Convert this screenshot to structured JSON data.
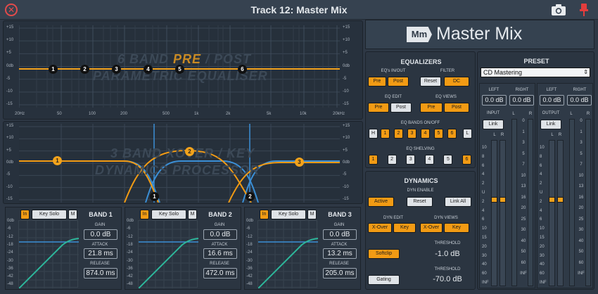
{
  "window": {
    "title": "Track 12: Master Mix"
  },
  "logo": {
    "badge": "Mm",
    "name": "Master Mix"
  },
  "eq_graph": {
    "db_labels": [
      "+15",
      "+10",
      "+5",
      "0db",
      "-5",
      "-10",
      "-15"
    ],
    "freq_labels": [
      "20Hz",
      "50",
      "100",
      "200",
      "500",
      "1k",
      "2k",
      "5k",
      "10k",
      "20kHz"
    ],
    "watermark_line1_a": "6 BAND ",
    "watermark_line1_b": "PRE",
    "watermark_line1_c": " / POST",
    "watermark_line2": "PARAMETRIC EQUALISER",
    "bands": [
      "1",
      "2",
      "3",
      "4",
      "5",
      "6"
    ]
  },
  "xover_graph": {
    "db_labels": [
      "+15",
      "+10",
      "+5",
      "0db",
      "-5",
      "-10",
      "-15"
    ],
    "watermark_line1": "3 BAND XOVER / KEY",
    "watermark_line2": "DYNAMICS PROCESSOR",
    "orange_bands": [
      "1",
      "2",
      "3"
    ],
    "crossover_points": [
      "1",
      "2"
    ]
  },
  "dyn_bands": [
    {
      "title": "BAND 1",
      "in": "In",
      "key_solo": "Key Solo",
      "m": "M",
      "gain_label": "GAIN",
      "gain": "0.0 dB",
      "attack_label": "ATTACK",
      "attack": "21.8 ms",
      "release_label": "RELEASE",
      "release": "874.0 ms",
      "scale": [
        "0db",
        "-6",
        "-12",
        "-18",
        "-24",
        "-30",
        "-36",
        "-42",
        "-48"
      ]
    },
    {
      "title": "BAND 2",
      "in": "In",
      "key_solo": "Key Solo",
      "m": "M",
      "gain_label": "GAIN",
      "gain": "0.0 dB",
      "attack_label": "ATTACK",
      "attack": "16.6 ms",
      "release_label": "RELEASE",
      "release": "472.0 ms",
      "scale": [
        "0db",
        "-6",
        "-12",
        "-18",
        "-24",
        "-30",
        "-36",
        "-42",
        "-48"
      ]
    },
    {
      "title": "BAND 3",
      "in": "In",
      "key_solo": "Key Solo",
      "m": "M",
      "gain_label": "GAIN",
      "gain": "0.0 dB",
      "attack_label": "ATTACK",
      "attack": "13.2 ms",
      "release_label": "RELEASE",
      "release": "205.0 ms",
      "scale": [
        "0db",
        "-6",
        "-12",
        "-18",
        "-24",
        "-30",
        "-36",
        "-42",
        "-48"
      ]
    }
  ],
  "equalizers": {
    "title": "EQUALIZERS",
    "eqs_inout_label": "EQ's IN/OUT",
    "filter_label": "FILTER",
    "pre": "Pre",
    "post": "Post",
    "reset": "Reset",
    "dc": "DC",
    "eq_edit_label": "EQ EDIT",
    "eq_views_label": "EQ VIEWS",
    "bands_label": "EQ BANDS ON/OFF",
    "h": "H",
    "l": "L",
    "band_buttons": [
      "1",
      "2",
      "3",
      "4",
      "5",
      "6"
    ],
    "shelving_label": "EQ SHELVING",
    "shelving_buttons": [
      "1",
      "2",
      "3",
      "4",
      "5",
      "6"
    ]
  },
  "dynamics": {
    "title": "DYNAMICS",
    "enable_label": "DYN ENABLE",
    "active": "Active",
    "reset": "Reset",
    "link_all": "Link All",
    "edit_label": "DYN EDIT",
    "views_label": "DYN VIEWS",
    "xover": "X-Over",
    "key": "Key",
    "softclip": "Softclip",
    "gating": "Gating",
    "threshold_label": "THRESHOLD",
    "softclip_threshold": "-1.0 dB",
    "gating_threshold": "-70.0 dB"
  },
  "preset": {
    "title": "PRESET",
    "selected": "CD Mastering",
    "input": {
      "label": "INPUT",
      "left": "LEFT",
      "right": "RIGHT",
      "left_val": "0.0 dB",
      "right_val": "0.0 dB",
      "link": "Link",
      "l": "L",
      "r": "R",
      "level_left": 0.6,
      "level_right": 0.6
    },
    "output": {
      "label": "OUTPUT",
      "left": "LEFT",
      "right": "RIGHT",
      "left_val": "0.0 dB",
      "right_val": "0.0 dB",
      "link": "Link",
      "l": "L",
      "r": "R",
      "level_left": 0.6,
      "level_right": 0.6
    },
    "fader_scale": [
      "10",
      "8",
      "6",
      "4",
      "2",
      "U",
      "2",
      "4",
      "6",
      "10",
      "15",
      "20",
      "30",
      "40",
      "60",
      "INF"
    ],
    "meter_scale": [
      "0",
      "1",
      "3",
      "5",
      "7",
      "10",
      "13",
      "16",
      "20",
      "25",
      "30",
      "40",
      "50",
      "60",
      "INF"
    ]
  },
  "colors": {
    "accent": "#f29b14",
    "blue": "#3b8fd6",
    "teal": "#2db79b"
  }
}
